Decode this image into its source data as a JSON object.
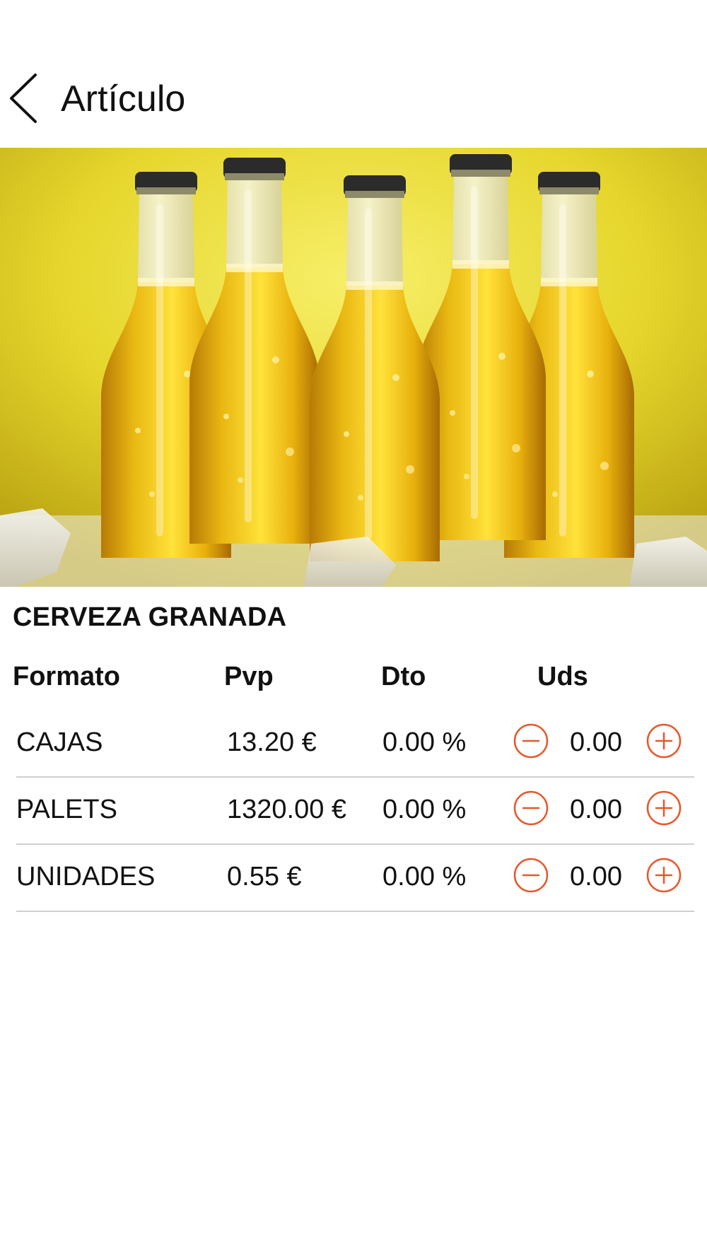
{
  "header": {
    "title": "Artículo",
    "back_icon": "chevron-left-icon"
  },
  "product": {
    "image_icon": "beer-bottles-photo",
    "name": "CERVEZA GRANADA"
  },
  "table": {
    "columns": [
      "Formato",
      "Pvp",
      "Dto",
      "Uds"
    ],
    "rows": [
      {
        "format": "CAJAS",
        "price": "13.20 €",
        "discount": "0.00 %",
        "units": "0.00"
      },
      {
        "format": "PALETS",
        "price": "1320.00 €",
        "discount": "0.00 %",
        "units": "0.00"
      },
      {
        "format": "UNIDADES",
        "price": "0.55 €",
        "discount": "0.00 %",
        "units": "0.00"
      }
    ]
  },
  "colors": {
    "accent": "#e8572a",
    "divider": "#cfcfcf",
    "text": "#111111"
  }
}
